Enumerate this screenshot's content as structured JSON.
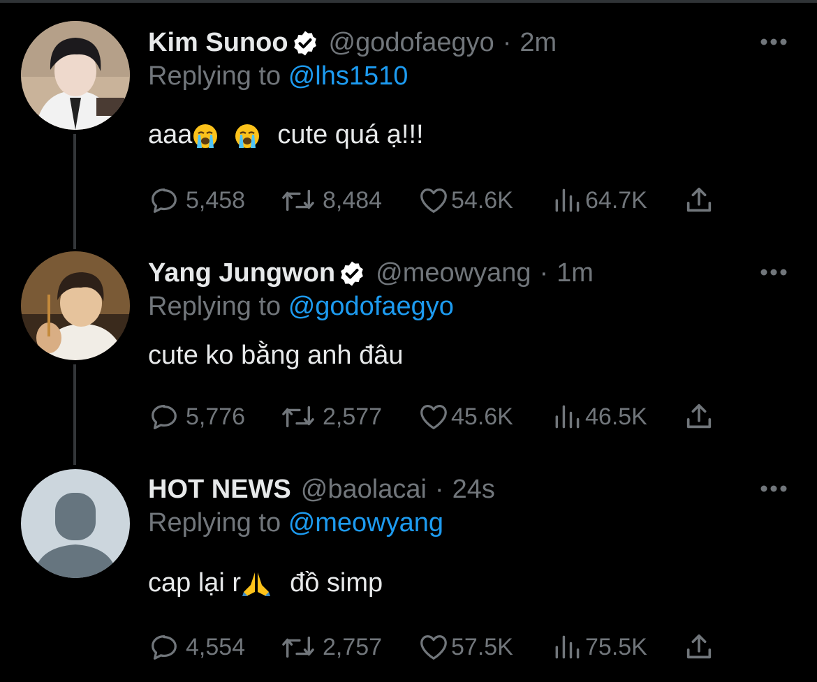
{
  "tweets": [
    {
      "name": "Kim Sunoo",
      "verified": true,
      "handle": "@godofaegyo",
      "separator": "·",
      "time": "2m",
      "replying_prefix": "Replying to",
      "replying_to": "@lhs1510",
      "text_a": "aaa",
      "text_b": "cute quá ạ!!!",
      "emojis": [
        "loudly-crying-face",
        "loudly-crying-face"
      ],
      "replies": "5,458",
      "retweets": "8,484",
      "likes": "54.6K",
      "views": "64.7K"
    },
    {
      "name": "Yang Jungwon",
      "verified": true,
      "handle": "@meowyang",
      "separator": "·",
      "time": "1m",
      "replying_prefix": "Replying to",
      "replying_to": "@godofaegyo",
      "text": "cute ko bằng anh đâu",
      "replies": "5,776",
      "retweets": "2,577",
      "likes": "45.6K",
      "views": "46.5K"
    },
    {
      "name": "HOT NEWS",
      "verified": false,
      "handle": "@baolacai",
      "separator": "·",
      "time": "24s",
      "replying_prefix": "Replying to",
      "replying_to": "@meowyang",
      "text_a": "cap lại r",
      "text_b": "đồ simp",
      "emojis": [
        "folded-hands"
      ],
      "replies": "4,554",
      "retweets": "2,757",
      "likes": "57.5K",
      "views": "75.5K"
    }
  ],
  "colors": {
    "background": "#000000",
    "text": "#e7e9ea",
    "muted": "#71767b",
    "link": "#1d9bf0",
    "thread_line": "#333639"
  }
}
